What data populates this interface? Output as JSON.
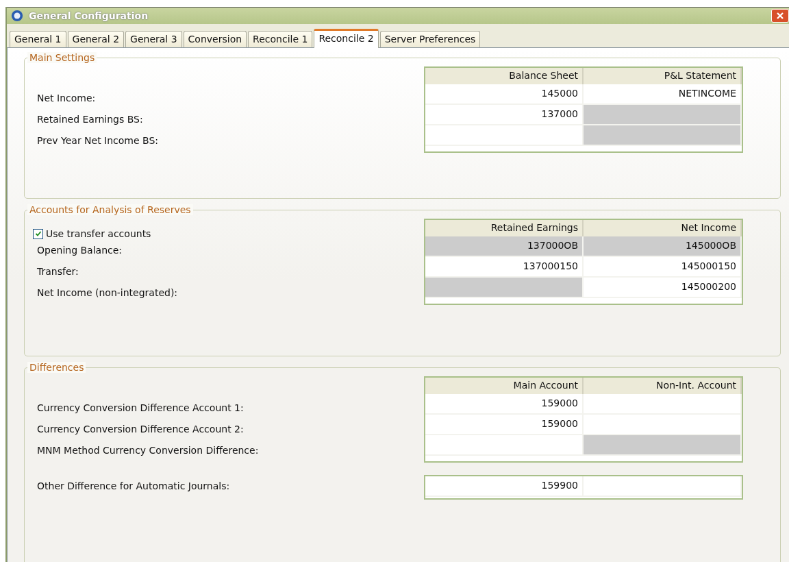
{
  "window": {
    "title": "General Configuration"
  },
  "tabs": [
    {
      "label": "General 1",
      "selected": false
    },
    {
      "label": "General 2",
      "selected": false
    },
    {
      "label": "General 3",
      "selected": false
    },
    {
      "label": "Conversion",
      "selected": false
    },
    {
      "label": "Reconcile 1",
      "selected": false
    },
    {
      "label": "Reconcile 2",
      "selected": true
    },
    {
      "label": "Server Preferences",
      "selected": false
    }
  ],
  "sections": [
    {
      "title": "Main Settings",
      "columns": [
        "Balance Sheet",
        "P&L Statement"
      ],
      "rows": [
        {
          "label": "Net Income:",
          "cells": [
            {
              "value": "145000",
              "disabled": false
            },
            {
              "value": "NETINCOME",
              "disabled": false
            }
          ]
        },
        {
          "label": "Retained Earnings BS:",
          "cells": [
            {
              "value": "137000",
              "disabled": false
            },
            {
              "disabled": true
            }
          ]
        },
        {
          "label": "Prev Year Net Income BS:",
          "cells": [
            {
              "disabled": false
            },
            {
              "disabled": true
            }
          ]
        }
      ]
    },
    {
      "title": "Accounts for Analysis of Reserves",
      "checkbox": {
        "label": "Use transfer accounts",
        "checked": true
      },
      "columns": [
        "Retained Earnings",
        "Net Income"
      ],
      "rows": [
        {
          "label": "Opening Balance:",
          "cells": [
            {
              "value": "137000OB",
              "disabled": true
            },
            {
              "value": "145000OB",
              "disabled": true
            }
          ]
        },
        {
          "label": "Transfer:",
          "cells": [
            {
              "value": "137000150",
              "disabled": false
            },
            {
              "value": "145000150",
              "disabled": false
            }
          ]
        },
        {
          "label": "Net Income (non-integrated):",
          "cells": [
            {
              "disabled": true
            },
            {
              "value": "145000200",
              "disabled": false
            }
          ]
        }
      ]
    },
    {
      "title": "Differences",
      "columns": [
        "Main Account",
        "Non-Int. Account"
      ],
      "rows": [
        {
          "label": "Currency Conversion Difference Account 1:",
          "cells": [
            {
              "value": "159000",
              "disabled": false
            },
            {
              "disabled": false
            }
          ]
        },
        {
          "label": "Currency Conversion Difference Account 2:",
          "cells": [
            {
              "value": "159000",
              "disabled": false
            },
            {
              "disabled": false
            }
          ]
        },
        {
          "label": "MNM Method Currency Conversion Difference:",
          "cells": [
            {
              "disabled": false
            },
            {
              "disabled": true
            }
          ]
        }
      ],
      "extra": {
        "label": "Other Difference for Automatic Journals:",
        "cells": [
          {
            "value": "159900",
            "disabled": false
          },
          {
            "disabled": false
          }
        ]
      }
    }
  ]
}
